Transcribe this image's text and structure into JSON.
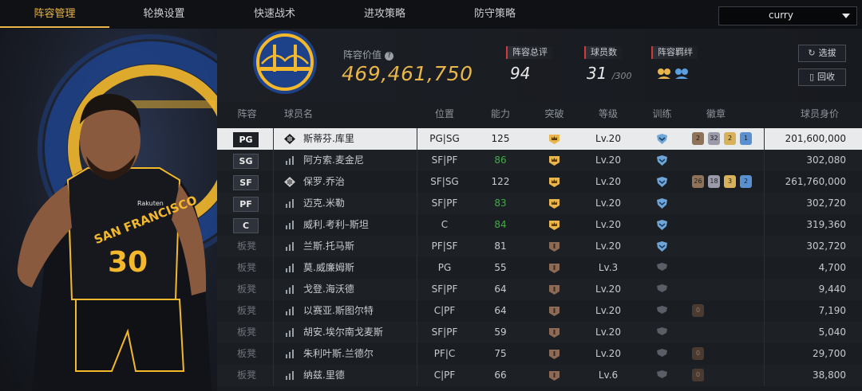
{
  "nav": {
    "tabs": [
      {
        "label": "阵容管理",
        "active": true
      },
      {
        "label": "轮换设置",
        "active": false
      },
      {
        "label": "快速战术",
        "active": false
      },
      {
        "label": "进攻策略",
        "active": false
      },
      {
        "label": "防守策略",
        "active": false
      }
    ],
    "player_select": "curry"
  },
  "summary": {
    "value_label": "阵容价值",
    "value": "469,461,750",
    "rating_label": "阵容总评",
    "rating": "94",
    "count_label": "球员数",
    "count": "31",
    "count_max": "/300",
    "chem_label": "阵容羁绊",
    "select_button": "选拔",
    "recycle_button": "回收"
  },
  "table": {
    "headers": [
      "阵容",
      "球员名",
      "位置",
      "能力",
      "突破",
      "等级",
      "训练",
      "徽章",
      "球员身价"
    ],
    "rows": [
      {
        "slot": "PG",
        "name": "斯蒂芬.库里",
        "pos": "PG|SG",
        "ability": "125",
        "level": "Lv.20",
        "price": "201,600,000",
        "badges": [
          "2",
          "32",
          "2",
          "1"
        ],
        "selected": true,
        "starter": true
      },
      {
        "slot": "SG",
        "name": "阿方索.麦金尼",
        "pos": "SF|PF",
        "ability": "86",
        "level": "Lv.20",
        "price": "302,080",
        "badges": [],
        "starter": true
      },
      {
        "slot": "SF",
        "name": "保罗.乔治",
        "pos": "SF|SG",
        "ability": "122",
        "level": "Lv.20",
        "price": "261,760,000",
        "badges": [
          "26",
          "18",
          "3",
          "2"
        ],
        "starter": true
      },
      {
        "slot": "PF",
        "name": "迈克.米勒",
        "pos": "SF|PF",
        "ability": "83",
        "level": "Lv.20",
        "price": "302,720",
        "badges": [],
        "starter": true
      },
      {
        "slot": "C",
        "name": "威利.考利–斯坦",
        "pos": "C",
        "ability": "84",
        "level": "Lv.20",
        "price": "319,360",
        "badges": [],
        "starter": true
      },
      {
        "slot": "板凳",
        "name": "兰斯.托马斯",
        "pos": "PF|SF",
        "ability": "81",
        "level": "Lv.20",
        "price": "302,720",
        "badges": []
      },
      {
        "slot": "板凳",
        "name": "莫.威廉姆斯",
        "pos": "PG",
        "ability": "55",
        "level": "Lv.3",
        "price": "4,700",
        "badges": []
      },
      {
        "slot": "板凳",
        "name": "戈登.海沃德",
        "pos": "SF|PF",
        "ability": "64",
        "level": "Lv.20",
        "price": "9,440",
        "badges": []
      },
      {
        "slot": "板凳",
        "name": "以赛亚.斯图尔特",
        "pos": "C|PF",
        "ability": "64",
        "level": "Lv.20",
        "price": "7,190",
        "badges": [
          "0"
        ]
      },
      {
        "slot": "板凳",
        "name": "胡安.埃尔南戈麦斯",
        "pos": "SF|PF",
        "ability": "59",
        "level": "Lv.20",
        "price": "5,040",
        "badges": []
      },
      {
        "slot": "板凳",
        "name": "朱利叶斯.兰德尔",
        "pos": "PF|C",
        "ability": "75",
        "level": "Lv.20",
        "price": "29,700",
        "badges": [
          "0"
        ]
      },
      {
        "slot": "板凳",
        "name": "纳兹.里德",
        "pos": "C|PF",
        "ability": "66",
        "level": "Lv.6",
        "price": "38,800",
        "badges": [
          "0"
        ]
      }
    ]
  },
  "hero": {
    "jersey_city": "SAN FRANCISCO",
    "jersey_number": "30",
    "jersey_sponsor": "Rakuten"
  },
  "colors": {
    "accent": "#e8b64a",
    "green": "#3fae45",
    "red": "#d13a3a"
  }
}
